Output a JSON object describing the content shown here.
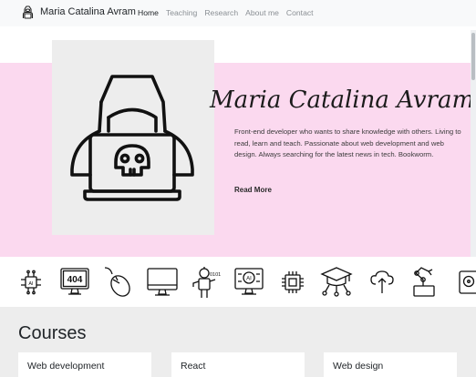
{
  "navbar": {
    "brand_name": "Maria Catalina Avram",
    "links": [
      "Home",
      "Teaching",
      "Research",
      "About me",
      "Contact"
    ],
    "active": "Home"
  },
  "hero": {
    "title": "Maria Catalina Avram",
    "description": "Front-end developer who wants to share knowledge with others. Living to read, learn and teach. Passionate about web development and web design. Always searching for the latest news in tech. Bookworm.",
    "read_more": "Read More",
    "image_icon": "hooded-hacker-with-laptop-skull-icon"
  },
  "tech_icons": [
    "ai-chip-icon",
    "404-monitor-icon",
    "computer-mouse-icon",
    "desktop-monitor-icon",
    "robot-binary-icon",
    "ai-monitor-icon",
    "cpu-chip-icon",
    "graduation-cap-network-icon",
    "cloud-upload-icon",
    "robot-arm-icon",
    "hard-drive-icon"
  ],
  "courses": {
    "heading": "Courses",
    "cards": [
      "Web development",
      "React",
      "Web design"
    ]
  },
  "colors": {
    "navbar_bg": "#f8f9fa",
    "hero_bg": "#fbd9ef",
    "image_bg": "#ededed",
    "courses_bg": "#ededed"
  }
}
